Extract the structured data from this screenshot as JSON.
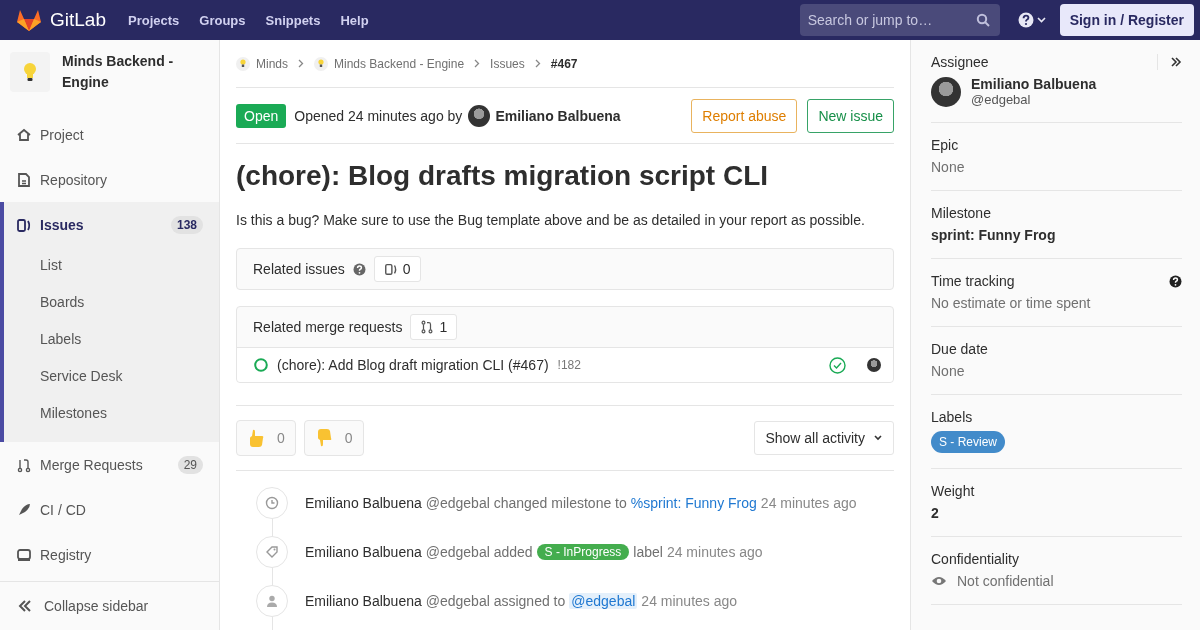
{
  "header": {
    "logo": "GitLab",
    "nav": [
      "Projects",
      "Groups",
      "Snippets",
      "Help"
    ],
    "search": {
      "placeholder": "Search or jump to…"
    },
    "sign_in": "Sign in / Register"
  },
  "sidebar": {
    "project": "Minds Backend - Engine",
    "items": [
      {
        "label": "Project",
        "selected": false
      },
      {
        "label": "Repository",
        "selected": false
      },
      {
        "label": "Issues",
        "badge": "138",
        "selected": true,
        "children": [
          {
            "label": "List",
            "selected": false
          },
          {
            "label": "Boards",
            "selected": false
          },
          {
            "label": "Labels",
            "selected": false
          },
          {
            "label": "Service Desk",
            "selected": false
          },
          {
            "label": "Milestones",
            "selected": false
          }
        ]
      },
      {
        "label": "Merge Requests",
        "badge": "29",
        "selected": false
      },
      {
        "label": "CI / CD",
        "selected": false
      },
      {
        "label": "Registry",
        "selected": false
      }
    ],
    "collapse": "Collapse sidebar"
  },
  "breadcrumbs": [
    "Minds",
    "Minds Backend - Engine",
    "Issues",
    "#467"
  ],
  "issue": {
    "status": "Open",
    "opened": "Opened 24 minutes ago by",
    "author": "Emiliano Balbuena",
    "buttons": [
      "Report abuse",
      "New issue"
    ],
    "title": "(chore): Blog drafts migration script CLI",
    "description": "Is this a bug? Make sure to use the Bug template above and be as detailed in your report as possible."
  },
  "related_issues": {
    "title": "Related issues",
    "count": "0"
  },
  "related_merge_requests": {
    "title": "Related merge requests",
    "count": "1",
    "items": [
      {
        "title": "(chore): Add Blog draft migration CLI (#467)",
        "ref": "!182"
      }
    ]
  },
  "awards": [
    {
      "count": "0"
    },
    {
      "count": "0"
    }
  ],
  "activity_filter": "Show all activity",
  "activity": [
    {
      "kind": "milestone",
      "parts": [
        {
          "kind": "author",
          "text": "Emiliano Balbuena"
        },
        {
          "kind": "text",
          "text": "@edgebal changed milestone to"
        },
        {
          "kind": "link",
          "text": "%sprint: Funny Frog"
        },
        {
          "kind": "time",
          "text": "24 minutes ago"
        }
      ]
    },
    {
      "kind": "label",
      "parts": [
        {
          "kind": "author",
          "text": "Emiliano Balbuena"
        },
        {
          "kind": "text",
          "text": "@edgebal added"
        },
        {
          "kind": "label",
          "text": "S - InProgress",
          "color": "#44ad4e"
        },
        {
          "kind": "text",
          "text": "label"
        },
        {
          "kind": "time",
          "text": "24 minutes ago"
        }
      ]
    },
    {
      "kind": "assign",
      "parts": [
        {
          "kind": "author",
          "text": "Emiliano Balbuena"
        },
        {
          "kind": "text",
          "text": "@edgebal assigned to"
        },
        {
          "kind": "mention",
          "text": "@edgebal"
        },
        {
          "kind": "time",
          "text": "24 minutes ago"
        }
      ]
    }
  ],
  "right_sidebar": {
    "assignee": {
      "title": "Assignee",
      "name": "Emiliano Balbuena",
      "username": "@edgebal"
    },
    "sections": [
      {
        "kind": "muted",
        "title": "Epic",
        "value": "None"
      },
      {
        "kind": "bold",
        "title": "Milestone",
        "value": "sprint: Funny Frog"
      },
      {
        "kind": "muted",
        "title": "Time tracking",
        "value": "No estimate or time spent",
        "help": true
      },
      {
        "kind": "muted",
        "title": "Due date",
        "value": "None"
      },
      {
        "kind": "label",
        "title": "Labels",
        "value": "S - Review",
        "color": "#428bca"
      },
      {
        "kind": "bold",
        "title": "Weight",
        "value": "2"
      },
      {
        "kind": "eye",
        "title": "Confidentiality",
        "value": "Not confidential"
      }
    ]
  }
}
